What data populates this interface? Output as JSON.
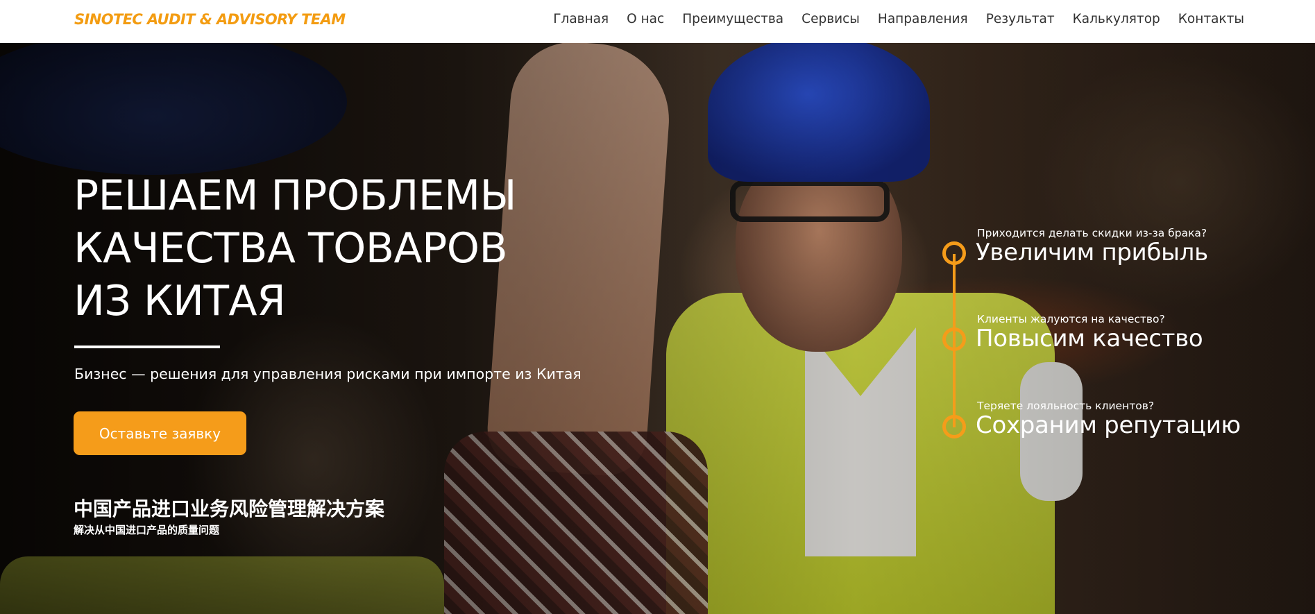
{
  "header": {
    "logo": "SINOTEC AUDIT & ADVISORY TEAM",
    "nav": [
      "Главная",
      "О нас",
      "Преимущества",
      "Сервисы",
      "Направления",
      "Результат",
      "Калькулятор",
      "Контакты"
    ]
  },
  "hero": {
    "headline": [
      "РЕШАЕМ ПРОБЛЕМЫ",
      "КАЧЕСТВА ТОВАРОВ",
      "ИЗ КИТАЯ"
    ],
    "subtitle": "Бизнес — решения для управления рисками при импорте из Китая",
    "cta_label": "Оставьте заявку",
    "cn_title": "中国产品进口业务风险管理解决方案",
    "cn_subtitle": "解决从中国进口产品的质量问题"
  },
  "benefits": [
    {
      "question": "Приходится делать скидки из-за брака?",
      "answer": "Увеличим прибыль"
    },
    {
      "question": "Клиенты жалуются на качество?",
      "answer": "Повысим качество"
    },
    {
      "question": "Теряете лояльность клиентов?",
      "answer": "Сохраним репутацию"
    }
  ],
  "colors": {
    "accent": "#f59c1a",
    "logo": "#f39c12",
    "header_bg": "#ffffff"
  }
}
